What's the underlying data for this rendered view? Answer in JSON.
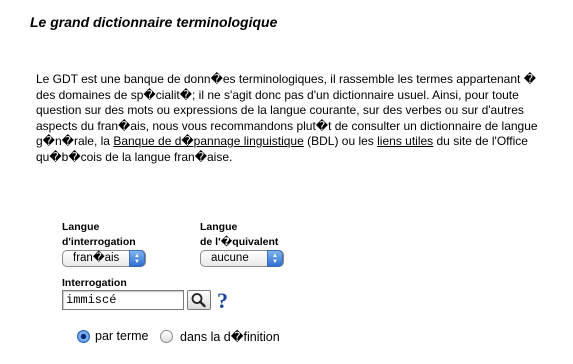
{
  "page": {
    "title": "Le grand dictionnaire terminologique"
  },
  "intro": {
    "part1": "Le GDT est une banque de donn�es terminologiques, il rassemble les termes appartenant � des domaines de sp�cialit�; il ne s'agit donc pas d'un dictionnaire usuel. Ainsi, pour toute question sur des mots ou expressions de la langue courante, sur des verbes ou sur d'autres aspects du fran�ais, nous vous recommandons plut�t de consulter un dictionnaire de langue g�n�rale, la ",
    "link1": "Banque de d�pannage linguistique",
    "part2": " (BDL) ou les ",
    "link2": "liens utiles",
    "part3": " du site de l'Office qu�b�cois de la langue fran�aise."
  },
  "form": {
    "interrogation_language": {
      "label_line1": "Langue",
      "label_line2": "d'interrogation",
      "selected": "fran�ais"
    },
    "equivalent_language": {
      "label_line1": "Langue",
      "label_line2": "de l'�quivalent",
      "selected": "aucune"
    },
    "query": {
      "label": "Interrogation",
      "value": "immiscé"
    },
    "help_symbol": "?",
    "search_mode": {
      "options": [
        {
          "label": "par terme",
          "selected": true
        },
        {
          "label": "dans la d�finition",
          "selected": false
        }
      ]
    }
  },
  "colors": {
    "accent_blue": "#2f6fd0",
    "help_blue": "#1d46a8"
  }
}
